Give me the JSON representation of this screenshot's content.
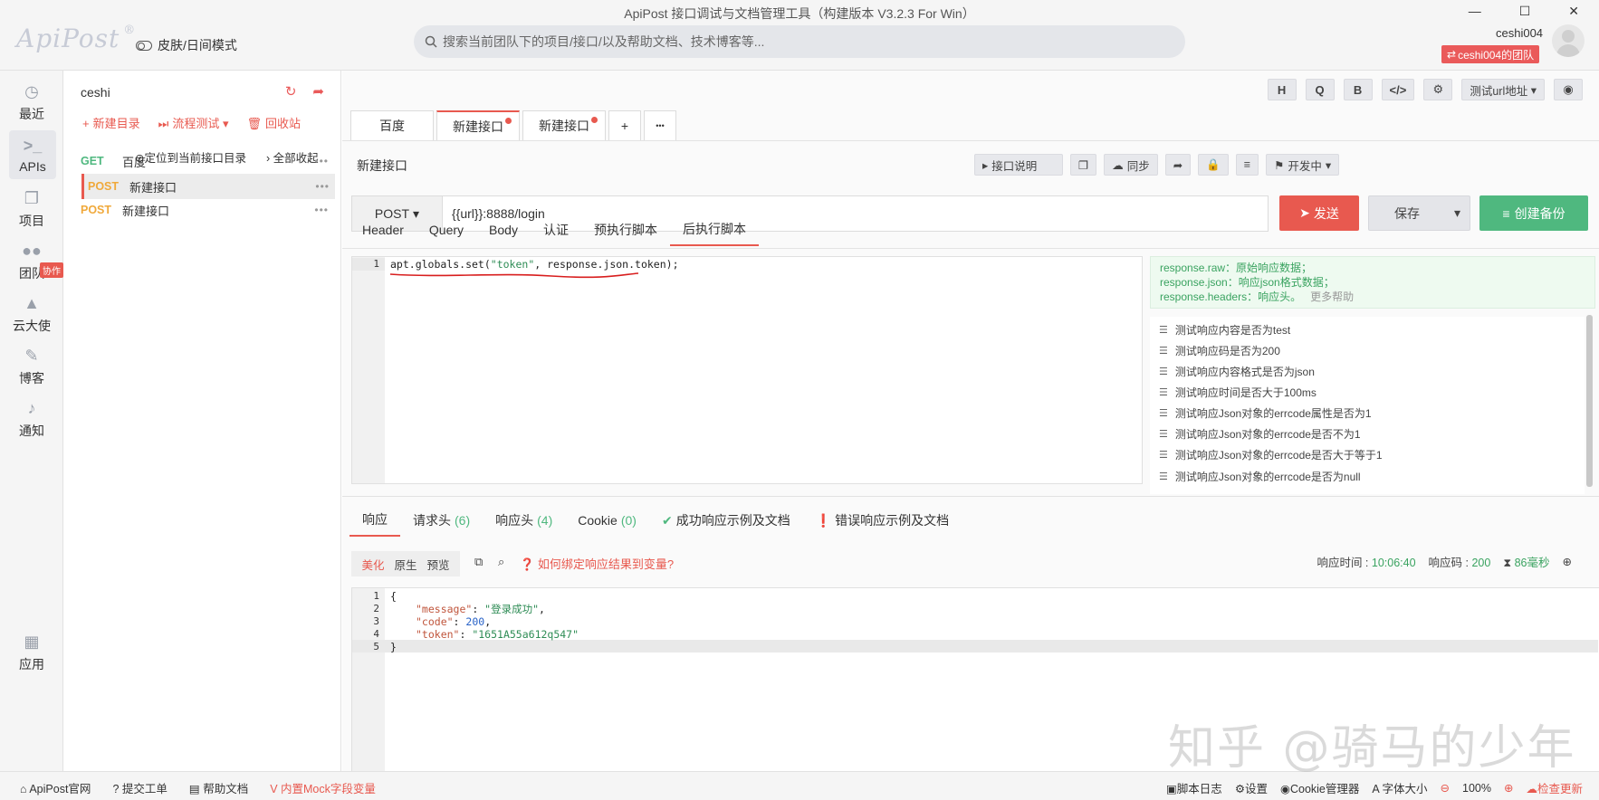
{
  "window": {
    "title": "ApiPost 接口调试与文档管理工具（构建版本 V3.2.3 For Win）",
    "min": "—",
    "max": "☐",
    "close": "✕"
  },
  "brand": {
    "logo": "ApiPost",
    "reg": "®"
  },
  "skin_label": "皮肤/日间模式",
  "search": {
    "placeholder": "搜索当前团队下的项目/接口/以及帮助文档、技术博客等..."
  },
  "user": {
    "name": "ceshi004",
    "team": "ceshi004的团队"
  },
  "nav": [
    {
      "label": "最近",
      "icon": "clock-icon"
    },
    {
      "label": "APIs",
      "icon": "terminal-icon"
    },
    {
      "label": "项目",
      "icon": "project-icon"
    },
    {
      "label": "团队",
      "icon": "team-icon",
      "badge": "协作"
    },
    {
      "label": "云大使",
      "icon": "graduation-icon"
    },
    {
      "label": "博客",
      "icon": "edit-icon"
    },
    {
      "label": "通知",
      "icon": "bell-icon"
    },
    {
      "label": "应用",
      "icon": "apps-icon"
    }
  ],
  "tree": {
    "title": "ceshi",
    "actions": [
      "新建目录",
      "流程测试",
      "回收站"
    ],
    "locate": "定位到当前接口目录",
    "collapse": "全部收起",
    "items": [
      {
        "method": "GET",
        "name": "百度",
        "color": "#4fb87f"
      },
      {
        "method": "POST",
        "name": "新建接口",
        "color": "#f0a93b"
      },
      {
        "method": "POST",
        "name": "新建接口",
        "color": "#f0a93b"
      }
    ]
  },
  "toolbar": {
    "h": "H",
    "q": "Q",
    "b": "B",
    "code": "</>",
    "settings": "⚙",
    "env": "测试url地址",
    "eye": "◉"
  },
  "tabs": [
    {
      "label": "百度"
    },
    {
      "label": "新建接口"
    },
    {
      "label": "新建接口"
    }
  ],
  "tab_add": "+",
  "tab_more": "•••",
  "request": {
    "name": "新建接口",
    "doc": "接口说明",
    "sync": "同步",
    "status": "开发中",
    "method": "POST",
    "url": "{{url}}:8888/login",
    "send": "发送",
    "save": "保存",
    "backup": "创建备份"
  },
  "subtabs": [
    "Header",
    "Query",
    "Body",
    "认证",
    "预执行脚本",
    "后执行脚本"
  ],
  "script": {
    "line": "1",
    "obj": "apt.globals.set(",
    "arg1": "\"token\"",
    "rest": ", response.json.token);"
  },
  "help": {
    "l1": "response.raw：原始响应数据；",
    "l2": "response.json：响应json格式数据；",
    "l3": "response.headers：响应头。",
    "more": "更多帮助"
  },
  "snippets": [
    "测试响应内容是否为test",
    "测试响应码是否为200",
    "测试响应内容格式是否为json",
    "测试响应时间是否大于100ms",
    "测试响应Json对象的errcode属性是否为1",
    "测试响应Json对象的errcode是否不为1",
    "测试响应Json对象的errcode是否大于等于1",
    "测试响应Json对象的errcode是否为null"
  ],
  "response": {
    "tabs": [
      {
        "label": "响应",
        "count": ""
      },
      {
        "label": "请求头",
        "count": "(6)"
      },
      {
        "label": "响应头",
        "count": "(4)"
      },
      {
        "label": "Cookie",
        "count": "(0)"
      },
      {
        "label": "成功响应示例及文档",
        "count": ""
      },
      {
        "label": "错误响应示例及文档",
        "count": ""
      }
    ],
    "modes": [
      "美化",
      "原生",
      "预览"
    ],
    "howto": "如何绑定响应结果到变量?",
    "time_label": "响应时间 :",
    "time": "10:06:40",
    "code_label": "响应码 :",
    "code": "200",
    "elapsed": "86毫秒",
    "body": {
      "open": "{",
      "k1": "\"message\"",
      "v1": "\"登录成功\"",
      "k2": "\"code\"",
      "v2": "200",
      "k3": "\"token\"",
      "v3": "\"1651A55a612q547\"",
      "close": "}"
    },
    "line_numbers": [
      "1",
      "2",
      "3",
      "4",
      "5"
    ]
  },
  "statusbar": {
    "left": [
      "ApiPost官网",
      "提交工单",
      "帮助文档",
      "内置Mock字段变量"
    ],
    "right": [
      "脚本日志",
      "设置",
      "Cookie管理器",
      "字体大小",
      "100%",
      "检查更新"
    ]
  },
  "watermark": "知乎 @骑马的少年"
}
